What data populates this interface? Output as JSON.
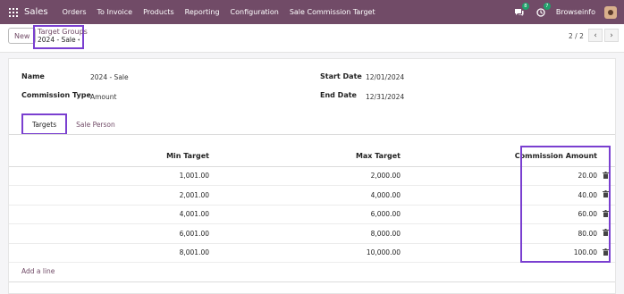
{
  "navbar": {
    "brand": "Sales",
    "menu": [
      "Orders",
      "To Invoice",
      "Products",
      "Reporting",
      "Configuration",
      "Sale Commission Target"
    ],
    "messages_badge": "8",
    "activities_badge": "7",
    "company": "Browseinfo"
  },
  "control": {
    "new_label": "New",
    "breadcrumb_parent": "Target Groups",
    "breadcrumb_current": "2024 - Sale",
    "pager": "2 / 2"
  },
  "form": {
    "name_label": "Name",
    "name_value": "2024 - Sale",
    "commission_type_label": "Commission Type",
    "commission_type_value": "Amount",
    "start_date_label": "Start Date",
    "start_date_value": "12/01/2024",
    "end_date_label": "End Date",
    "end_date_value": "12/31/2024"
  },
  "tabs": [
    "Targets",
    "Sale Person"
  ],
  "table": {
    "headers": [
      "Min Target",
      "Max Target",
      "Commission Amount"
    ],
    "rows": [
      [
        "1,001.00",
        "2,000.00",
        "20.00"
      ],
      [
        "2,001.00",
        "4,000.00",
        "40.00"
      ],
      [
        "4,001.00",
        "6,000.00",
        "60.00"
      ],
      [
        "6,001.00",
        "8,000.00",
        "80.00"
      ],
      [
        "8,001.00",
        "10,000.00",
        "100.00"
      ]
    ],
    "add_line": "Add a line"
  },
  "colors": {
    "navbar": "#714b67",
    "highlight": "#7a3fd0",
    "badge": "#21a06b"
  }
}
